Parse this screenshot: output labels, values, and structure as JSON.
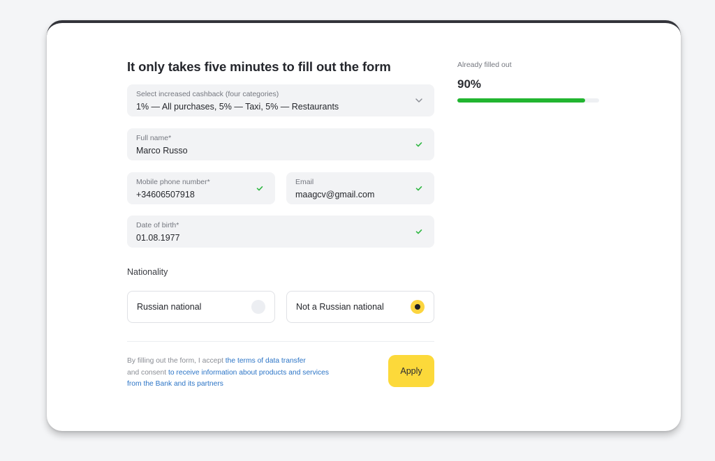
{
  "form": {
    "title": "It only takes five minutes to fill out the form",
    "cashback": {
      "label": "Select increased cashback (four categories)",
      "value": "1% — All purchases, 5% — Taxi, 5% — Restaurants",
      "icon": "chevron-down-icon"
    },
    "full_name": {
      "label": "Full name*",
      "value": "Marco Russo",
      "icon": "check-icon"
    },
    "phone": {
      "label": "Mobile phone number*",
      "value": "+34606507918",
      "icon": "check-icon"
    },
    "email": {
      "label": "Email",
      "value": "maagcv@gmail.com",
      "icon": "check-icon"
    },
    "birth_date": {
      "label": "Date of birth*",
      "value": "01.08.1977",
      "icon": "check-icon"
    },
    "nationality": {
      "label": "Nationality",
      "options": [
        {
          "label": "Russian national",
          "selected": false
        },
        {
          "label": "Not a Russian national",
          "selected": true
        }
      ]
    },
    "consent": {
      "text_1": "By filling out the form, I accept ",
      "link_1": "the terms of data transfer",
      "text_2": "and consent ",
      "link_2": "to receive information about products and services from the Bank and its partners"
    },
    "apply_label": "Apply"
  },
  "progress": {
    "label": "Already filled out",
    "value_text": "90%",
    "fraction": 0.9
  },
  "colors": {
    "accent_yellow": "#fcd93a",
    "check_green": "#2fb742",
    "progress_green": "#21b530",
    "link_blue": "#2b74c6"
  }
}
